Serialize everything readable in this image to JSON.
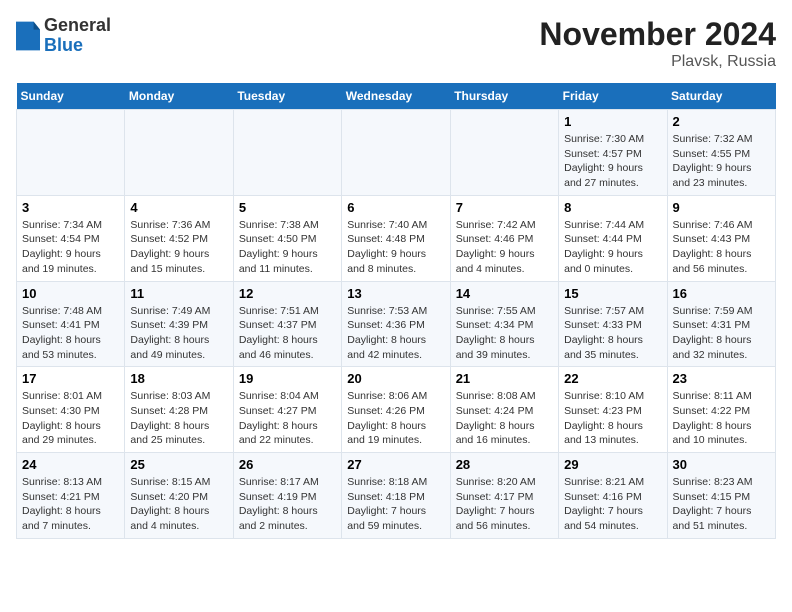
{
  "logo": {
    "general": "General",
    "blue": "Blue"
  },
  "title": "November 2024",
  "subtitle": "Plavsk, Russia",
  "weekdays": [
    "Sunday",
    "Monday",
    "Tuesday",
    "Wednesday",
    "Thursday",
    "Friday",
    "Saturday"
  ],
  "weeks": [
    [
      {
        "day": "",
        "info": ""
      },
      {
        "day": "",
        "info": ""
      },
      {
        "day": "",
        "info": ""
      },
      {
        "day": "",
        "info": ""
      },
      {
        "day": "",
        "info": ""
      },
      {
        "day": "1",
        "info": "Sunrise: 7:30 AM\nSunset: 4:57 PM\nDaylight: 9 hours\nand 27 minutes."
      },
      {
        "day": "2",
        "info": "Sunrise: 7:32 AM\nSunset: 4:55 PM\nDaylight: 9 hours\nand 23 minutes."
      }
    ],
    [
      {
        "day": "3",
        "info": "Sunrise: 7:34 AM\nSunset: 4:54 PM\nDaylight: 9 hours\nand 19 minutes."
      },
      {
        "day": "4",
        "info": "Sunrise: 7:36 AM\nSunset: 4:52 PM\nDaylight: 9 hours\nand 15 minutes."
      },
      {
        "day": "5",
        "info": "Sunrise: 7:38 AM\nSunset: 4:50 PM\nDaylight: 9 hours\nand 11 minutes."
      },
      {
        "day": "6",
        "info": "Sunrise: 7:40 AM\nSunset: 4:48 PM\nDaylight: 9 hours\nand 8 minutes."
      },
      {
        "day": "7",
        "info": "Sunrise: 7:42 AM\nSunset: 4:46 PM\nDaylight: 9 hours\nand 4 minutes."
      },
      {
        "day": "8",
        "info": "Sunrise: 7:44 AM\nSunset: 4:44 PM\nDaylight: 9 hours\nand 0 minutes."
      },
      {
        "day": "9",
        "info": "Sunrise: 7:46 AM\nSunset: 4:43 PM\nDaylight: 8 hours\nand 56 minutes."
      }
    ],
    [
      {
        "day": "10",
        "info": "Sunrise: 7:48 AM\nSunset: 4:41 PM\nDaylight: 8 hours\nand 53 minutes."
      },
      {
        "day": "11",
        "info": "Sunrise: 7:49 AM\nSunset: 4:39 PM\nDaylight: 8 hours\nand 49 minutes."
      },
      {
        "day": "12",
        "info": "Sunrise: 7:51 AM\nSunset: 4:37 PM\nDaylight: 8 hours\nand 46 minutes."
      },
      {
        "day": "13",
        "info": "Sunrise: 7:53 AM\nSunset: 4:36 PM\nDaylight: 8 hours\nand 42 minutes."
      },
      {
        "day": "14",
        "info": "Sunrise: 7:55 AM\nSunset: 4:34 PM\nDaylight: 8 hours\nand 39 minutes."
      },
      {
        "day": "15",
        "info": "Sunrise: 7:57 AM\nSunset: 4:33 PM\nDaylight: 8 hours\nand 35 minutes."
      },
      {
        "day": "16",
        "info": "Sunrise: 7:59 AM\nSunset: 4:31 PM\nDaylight: 8 hours\nand 32 minutes."
      }
    ],
    [
      {
        "day": "17",
        "info": "Sunrise: 8:01 AM\nSunset: 4:30 PM\nDaylight: 8 hours\nand 29 minutes."
      },
      {
        "day": "18",
        "info": "Sunrise: 8:03 AM\nSunset: 4:28 PM\nDaylight: 8 hours\nand 25 minutes."
      },
      {
        "day": "19",
        "info": "Sunrise: 8:04 AM\nSunset: 4:27 PM\nDaylight: 8 hours\nand 22 minutes."
      },
      {
        "day": "20",
        "info": "Sunrise: 8:06 AM\nSunset: 4:26 PM\nDaylight: 8 hours\nand 19 minutes."
      },
      {
        "day": "21",
        "info": "Sunrise: 8:08 AM\nSunset: 4:24 PM\nDaylight: 8 hours\nand 16 minutes."
      },
      {
        "day": "22",
        "info": "Sunrise: 8:10 AM\nSunset: 4:23 PM\nDaylight: 8 hours\nand 13 minutes."
      },
      {
        "day": "23",
        "info": "Sunrise: 8:11 AM\nSunset: 4:22 PM\nDaylight: 8 hours\nand 10 minutes."
      }
    ],
    [
      {
        "day": "24",
        "info": "Sunrise: 8:13 AM\nSunset: 4:21 PM\nDaylight: 8 hours\nand 7 minutes."
      },
      {
        "day": "25",
        "info": "Sunrise: 8:15 AM\nSunset: 4:20 PM\nDaylight: 8 hours\nand 4 minutes."
      },
      {
        "day": "26",
        "info": "Sunrise: 8:17 AM\nSunset: 4:19 PM\nDaylight: 8 hours\nand 2 minutes."
      },
      {
        "day": "27",
        "info": "Sunrise: 8:18 AM\nSunset: 4:18 PM\nDaylight: 7 hours\nand 59 minutes."
      },
      {
        "day": "28",
        "info": "Sunrise: 8:20 AM\nSunset: 4:17 PM\nDaylight: 7 hours\nand 56 minutes."
      },
      {
        "day": "29",
        "info": "Sunrise: 8:21 AM\nSunset: 4:16 PM\nDaylight: 7 hours\nand 54 minutes."
      },
      {
        "day": "30",
        "info": "Sunrise: 8:23 AM\nSunset: 4:15 PM\nDaylight: 7 hours\nand 51 minutes."
      }
    ]
  ]
}
